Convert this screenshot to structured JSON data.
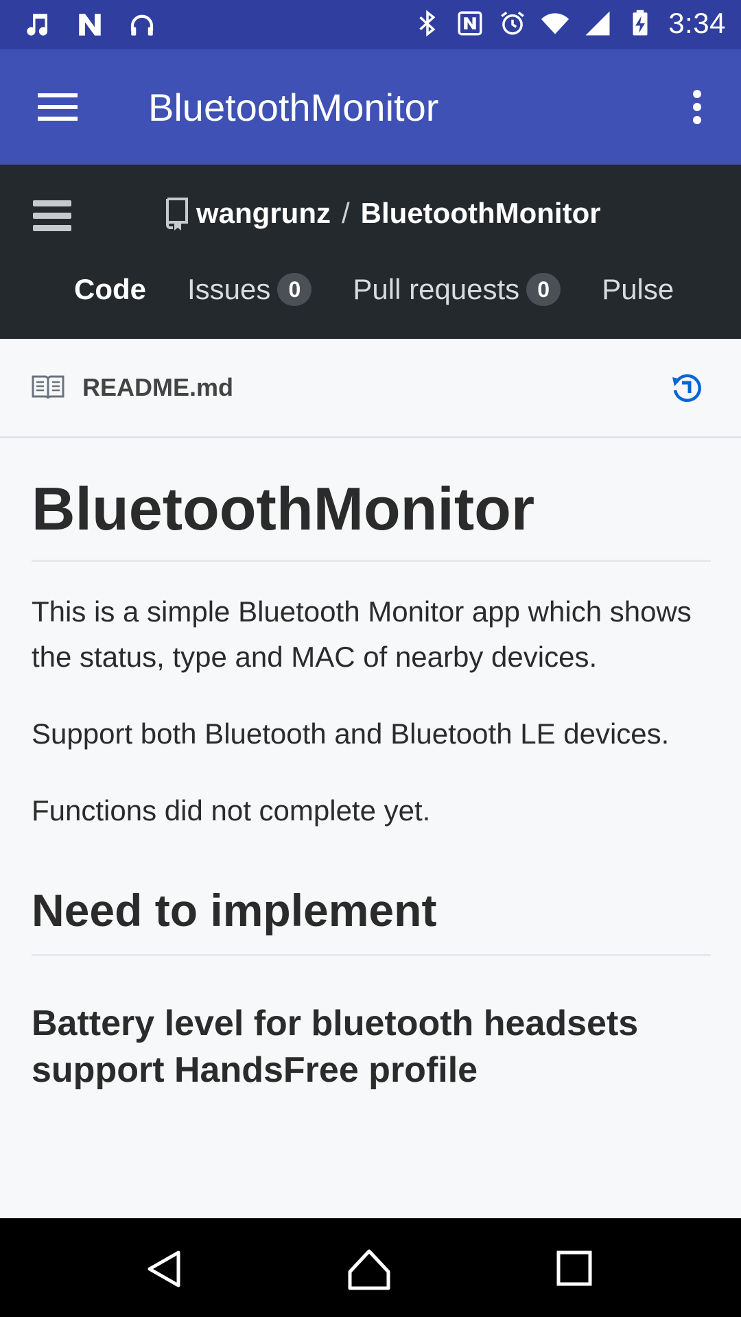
{
  "status_bar": {
    "time": "3:34",
    "left_icons": [
      "music-note-icon",
      "n-icon",
      "headphones-icon"
    ],
    "right_icons": [
      "bluetooth-icon",
      "nfc-icon",
      "alarm-icon",
      "wifi-icon",
      "signal-icon",
      "battery-charging-icon"
    ]
  },
  "app_bar": {
    "title": "BluetoothMonitor",
    "color": "#3f51b5"
  },
  "github_header": {
    "owner": "wangrunz",
    "separator": "/",
    "repo": "BluetoothMonitor",
    "tabs": [
      {
        "label": "Code",
        "active": true
      },
      {
        "label": "Issues",
        "count": "0"
      },
      {
        "label": "Pull requests",
        "count": "0"
      },
      {
        "label": "Pulse"
      }
    ]
  },
  "readme": {
    "filename": "README.md",
    "h1": "BluetoothMonitor",
    "p1": "This is a simple Bluetooth Monitor app which shows the status, type and MAC of nearby devices.",
    "p2": "Support both Bluetooth and Bluetooth LE devices.",
    "p3": "Functions did not complete yet.",
    "h2": "Need to implement",
    "h3": "Battery level for bluetooth headsets support HandsFree profile"
  },
  "colors": {
    "status_bar": "#303f9f",
    "github_dark": "#24292e",
    "history_icon": "#0366d6"
  }
}
